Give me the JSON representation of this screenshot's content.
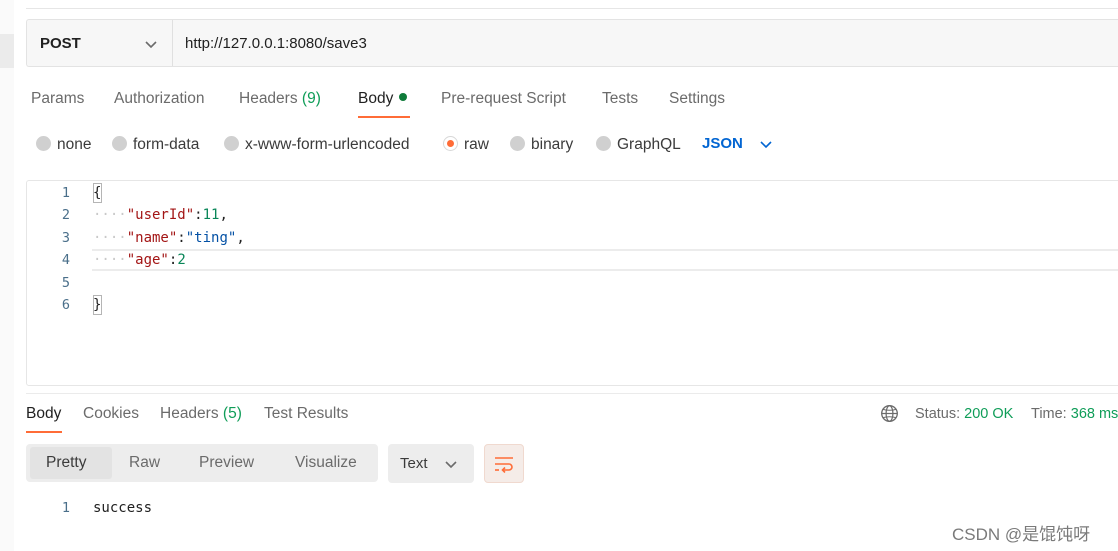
{
  "request": {
    "method": "POST",
    "url": "http://127.0.0.1:8080/save3"
  },
  "request_tabs": {
    "params": "Params",
    "authorization": "Authorization",
    "headers_label": "Headers",
    "headers_count": "(9)",
    "body": "Body",
    "prerequest": "Pre-request Script",
    "tests": "Tests",
    "settings": "Settings"
  },
  "body_types": {
    "none": "none",
    "form_data": "form-data",
    "urlencoded": "x-www-form-urlencoded",
    "raw": "raw",
    "binary": "binary",
    "graphql": "GraphQL",
    "format": "JSON"
  },
  "editor": {
    "line_numbers": [
      "1",
      "2",
      "3",
      "4",
      "5",
      "6"
    ],
    "open_brace": "{",
    "close_brace": "}",
    "indent": "····",
    "lines": [
      {
        "key": "\"userId\"",
        "colon": ":",
        "value": "11",
        "comma": ","
      },
      {
        "key": "\"name\"",
        "colon": ":",
        "value": "\"ting\"",
        "comma": ","
      },
      {
        "key": "\"age\"",
        "colon": ":",
        "value": "2",
        "comma": ""
      }
    ]
  },
  "response_tabs": {
    "body": "Body",
    "cookies": "Cookies",
    "headers_label": "Headers",
    "headers_count": "(5)",
    "test_results": "Test Results"
  },
  "response_status": {
    "status_label": "Status:",
    "status_value": "200 OK",
    "time_label": "Time:",
    "time_value": "368 ms"
  },
  "response_view": {
    "pretty": "Pretty",
    "raw": "Raw",
    "preview": "Preview",
    "visualize": "Visualize",
    "text_format": "Text"
  },
  "response_body": {
    "line_number": "1",
    "content": "success"
  },
  "watermark": "CSDN @是馄饨呀",
  "colors": {
    "accent": "#ff6c37",
    "status_ok": "#0f9d58",
    "json_blue": "#0265d2"
  }
}
